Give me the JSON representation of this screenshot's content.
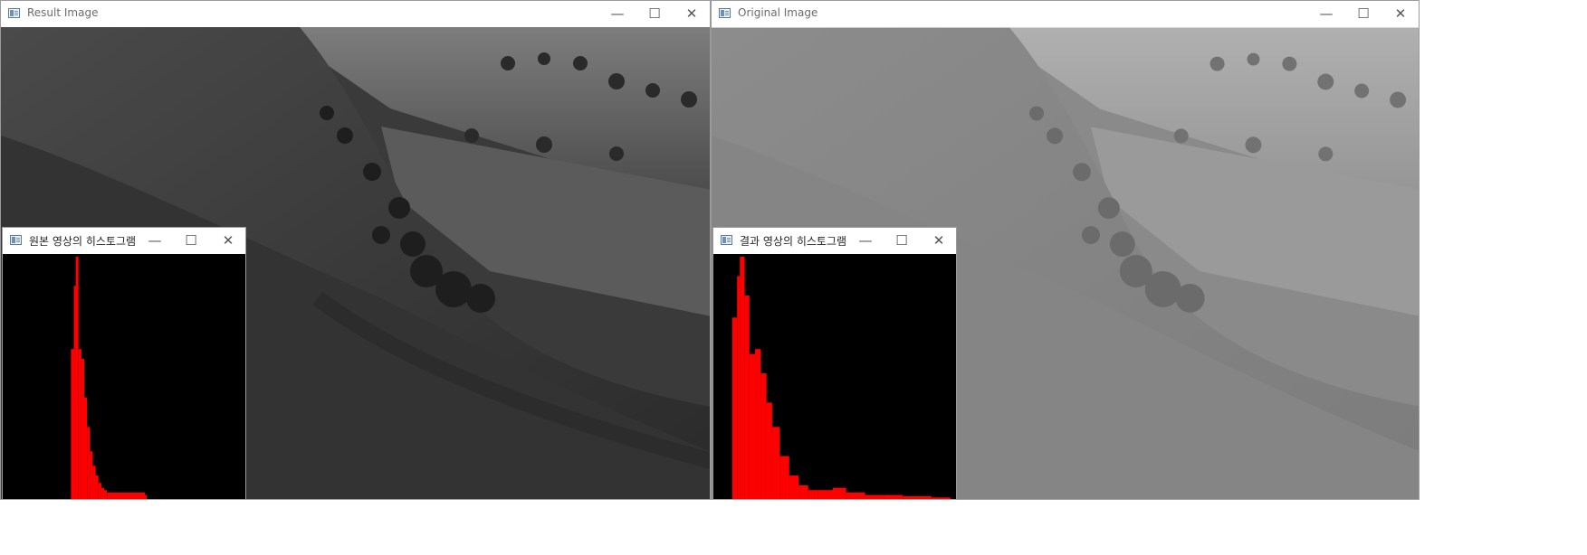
{
  "windows": {
    "result": {
      "title": "Result Image",
      "minimize_label": "—",
      "maximize_label": "☐",
      "close_label": "✕"
    },
    "original": {
      "title": "Original Image",
      "minimize_label": "—",
      "maximize_label": "☐",
      "close_label": "✕"
    },
    "hist_original": {
      "title": "원본 영상의 히스토그램",
      "minimize_label": "—",
      "maximize_label": "☐",
      "close_label": "✕"
    },
    "hist_result": {
      "title": "결과 영상의 히스토그램",
      "minimize_label": "—",
      "maximize_label": "☐",
      "close_label": "✕"
    }
  },
  "colors": {
    "histogram_bar": "#ff0000",
    "histogram_bg": "#000000",
    "titlebar": "#ffffff",
    "title_text": "#6b6b6b"
  },
  "icons": {
    "window_icon": "opencv-window-icon",
    "minimize": "minimize-icon",
    "maximize": "maximize-icon",
    "close": "close-icon"
  },
  "histograms": {
    "original": {
      "chart_data": {
        "type": "bar",
        "x_range": [
          0,
          255
        ],
        "bins": [
          [
            72,
            0.62
          ],
          [
            75,
            0.88
          ],
          [
            77,
            1.0
          ],
          [
            80,
            0.62
          ],
          [
            83,
            0.58
          ],
          [
            86,
            0.42
          ],
          [
            89,
            0.3
          ],
          [
            92,
            0.2
          ],
          [
            95,
            0.14
          ],
          [
            98,
            0.1
          ],
          [
            101,
            0.07
          ],
          [
            104,
            0.05
          ],
          [
            107,
            0.04
          ],
          [
            110,
            0.03
          ],
          [
            150,
            0.02
          ]
        ]
      }
    },
    "result": {
      "chart_data": {
        "type": "bar",
        "x_range": [
          0,
          255
        ],
        "bins": [
          [
            20,
            0.75
          ],
          [
            25,
            0.92
          ],
          [
            28,
            1.0
          ],
          [
            33,
            0.84
          ],
          [
            38,
            0.6
          ],
          [
            44,
            0.62
          ],
          [
            50,
            0.52
          ],
          [
            56,
            0.4
          ],
          [
            62,
            0.3
          ],
          [
            70,
            0.18
          ],
          [
            80,
            0.1
          ],
          [
            90,
            0.06
          ],
          [
            100,
            0.04
          ],
          [
            110,
            0.04
          ],
          [
            126,
            0.05
          ],
          [
            140,
            0.03
          ],
          [
            160,
            0.02
          ],
          [
            180,
            0.02
          ],
          [
            200,
            0.015
          ],
          [
            230,
            0.01
          ],
          [
            250,
            0.005
          ]
        ]
      }
    }
  }
}
